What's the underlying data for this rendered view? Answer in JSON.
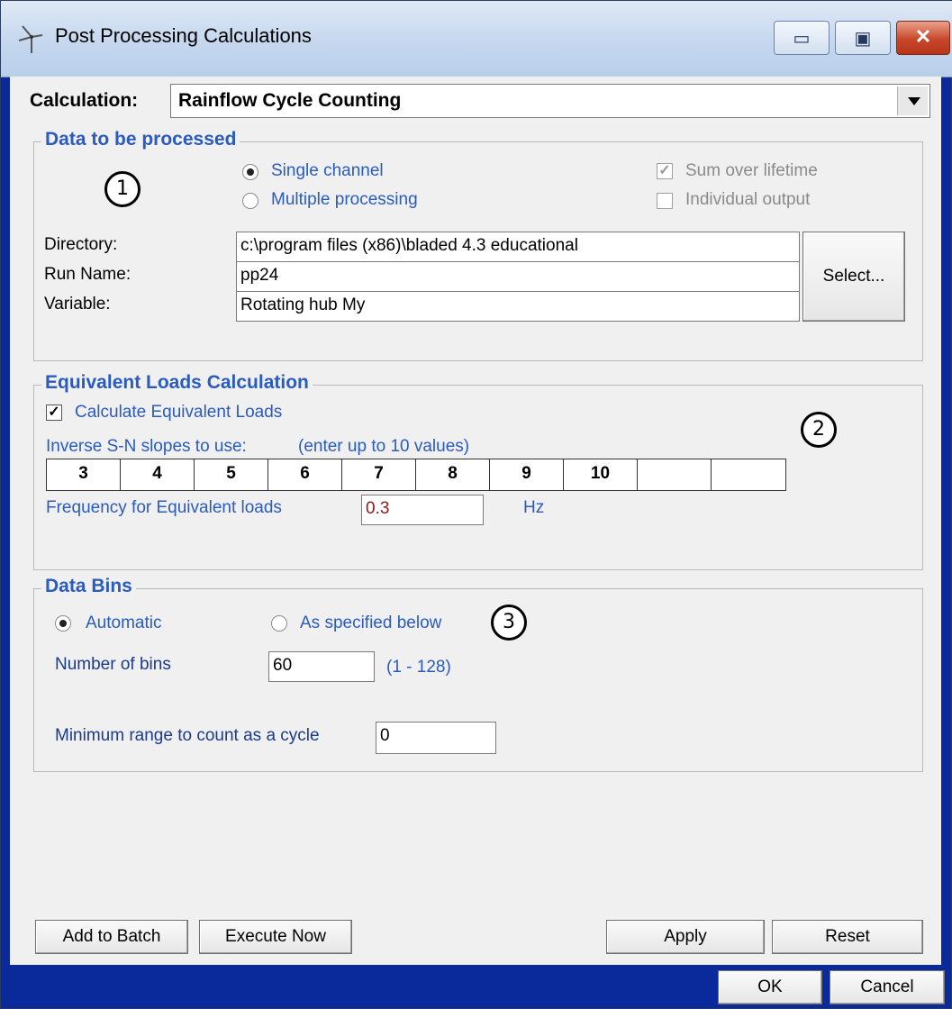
{
  "window": {
    "title": "Post Processing Calculations"
  },
  "calculation": {
    "label": "Calculation:",
    "value": "Rainflow Cycle Counting"
  },
  "data_group": {
    "title": "Data to be processed",
    "annotation": "1",
    "single_channel": "Single channel",
    "multiple_processing": "Multiple processing",
    "sum_over_lifetime": "Sum over lifetime",
    "individual_output": "Individual output",
    "directory_label": "Directory:",
    "directory_value": "c:\\program files (x86)\\bladed 4.3 educational",
    "run_name_label": "Run Name:",
    "run_name_value": "pp24",
    "variable_label": "Variable:",
    "variable_value": "Rotating hub My",
    "select_button": "Select..."
  },
  "equiv_group": {
    "title": "Equivalent Loads Calculation",
    "annotation": "2",
    "calc_checkbox": "Calculate Equivalent Loads",
    "slopes_label": "Inverse S-N slopes to use:",
    "slopes_hint": "(enter up to 10 values)",
    "slopes": [
      "3",
      "4",
      "5",
      "6",
      "7",
      "8",
      "9",
      "10",
      "",
      ""
    ],
    "freq_label": "Frequency for Equivalent loads",
    "freq_value": "0.3",
    "freq_unit": "Hz"
  },
  "bins_group": {
    "title": "Data Bins",
    "annotation": "3",
    "automatic": "Automatic",
    "as_specified": "As specified below",
    "num_bins_label": "Number of bins",
    "num_bins_value": "60",
    "num_bins_range": "(1 - 128)",
    "min_range_label": "Minimum range to count as a cycle",
    "min_range_value": "0"
  },
  "buttons": {
    "add_to_batch": "Add to Batch",
    "execute_now": "Execute Now",
    "apply": "Apply",
    "reset": "Reset",
    "ok": "OK",
    "cancel": "Cancel"
  }
}
